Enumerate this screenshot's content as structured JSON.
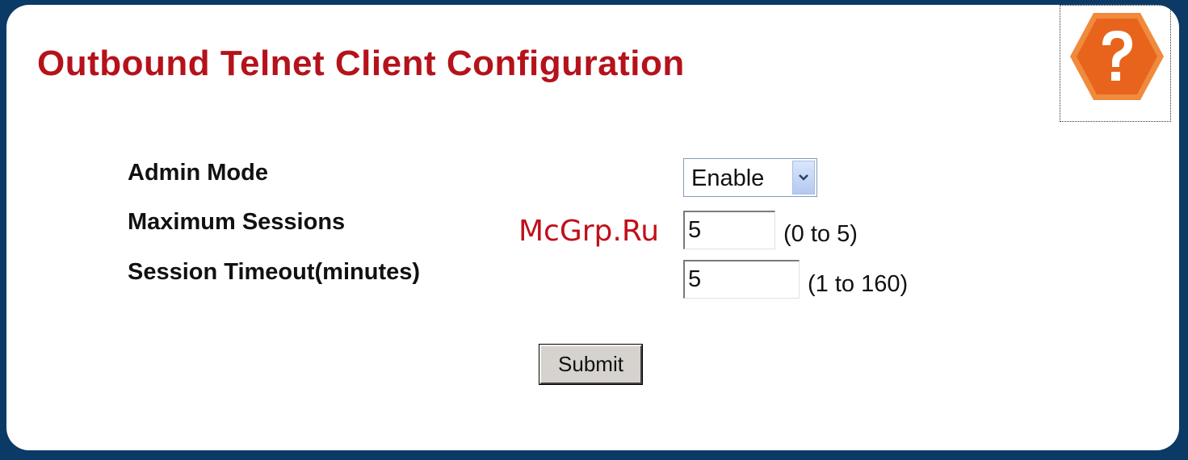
{
  "page": {
    "title": "Outbound Telnet Client Configuration"
  },
  "help": {
    "icon": "help-question-icon",
    "color": "#e8641c"
  },
  "form": {
    "admin_mode": {
      "label": "Admin Mode",
      "selected": "Enable"
    },
    "max_sessions": {
      "label": "Maximum Sessions",
      "value": "5",
      "range": "(0 to 5)"
    },
    "session_timeout": {
      "label": "Session Timeout(minutes)",
      "value": "5",
      "range": "(1 to 160)"
    },
    "submit_label": "Submit"
  },
  "watermark": "McGrp.Ru",
  "colors": {
    "frame": "#0b3a66",
    "title": "#b5121b"
  }
}
